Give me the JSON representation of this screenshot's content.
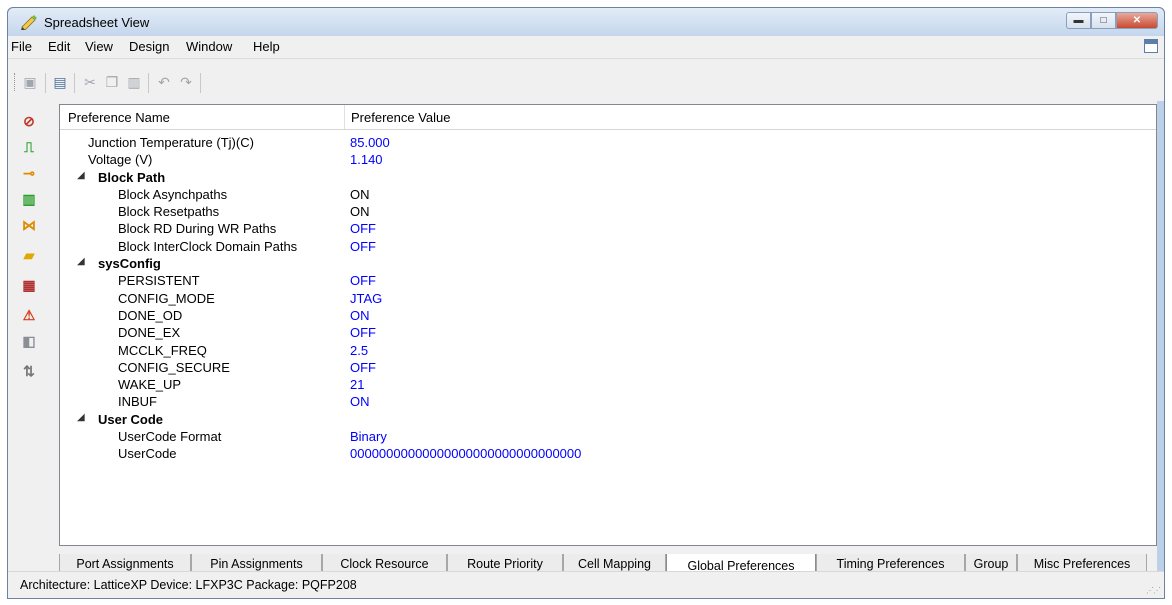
{
  "window": {
    "title": "Spreadsheet View"
  },
  "menu": [
    "File",
    "Edit",
    "View",
    "Design",
    "Window",
    "Help"
  ],
  "grid": {
    "headers": {
      "name": "Preference Name",
      "value": "Preference Value"
    },
    "rows": [
      {
        "indent": 1,
        "name": "Junction Temperature (Tj)(C)",
        "value": "85.000",
        "blue": true
      },
      {
        "indent": 1,
        "name": "Voltage (V)",
        "value": "1.140",
        "blue": true
      },
      {
        "indent": 0,
        "group": true,
        "name": "Block Path"
      },
      {
        "indent": 2,
        "name": "Block Asynchpaths",
        "value": "ON",
        "blue": false
      },
      {
        "indent": 2,
        "name": "Block Resetpaths",
        "value": "ON",
        "blue": false
      },
      {
        "indent": 2,
        "name": "Block RD During WR Paths",
        "value": "OFF",
        "blue": true
      },
      {
        "indent": 2,
        "name": "Block InterClock Domain Paths",
        "value": "OFF",
        "blue": true
      },
      {
        "indent": 0,
        "group": true,
        "name": "sysConfig"
      },
      {
        "indent": 2,
        "name": "PERSISTENT",
        "value": "OFF",
        "blue": true
      },
      {
        "indent": 2,
        "name": "CONFIG_MODE",
        "value": "JTAG",
        "blue": true
      },
      {
        "indent": 2,
        "name": "DONE_OD",
        "value": "ON",
        "blue": true
      },
      {
        "indent": 2,
        "name": "DONE_EX",
        "value": "OFF",
        "blue": true
      },
      {
        "indent": 2,
        "name": "MCCLK_FREQ",
        "value": "2.5",
        "blue": true
      },
      {
        "indent": 2,
        "name": "CONFIG_SECURE",
        "value": "OFF",
        "blue": true
      },
      {
        "indent": 2,
        "name": "WAKE_UP",
        "value": "21",
        "blue": true
      },
      {
        "indent": 2,
        "name": "INBUF",
        "value": "ON",
        "blue": true
      },
      {
        "indent": 0,
        "group": true,
        "name": "User Code"
      },
      {
        "indent": 2,
        "name": "UserCode Format",
        "value": "Binary",
        "blue": true
      },
      {
        "indent": 2,
        "name": "UserCode",
        "value": "00000000000000000000000000000000",
        "blue": true
      }
    ]
  },
  "tabs": [
    "Port Assignments",
    "Pin Assignments",
    "Clock Resource",
    "Route Priority",
    "Cell Mapping",
    "Global Preferences",
    "Timing Preferences",
    "Group",
    "Misc Preferences"
  ],
  "active_tab": "Global Preferences",
  "status": {
    "text": "Architecture: LatticeXP  Device: LFXP3C  Package: PQFP208"
  },
  "colors": {
    "value_blue": "#0000ff",
    "titlebar": "#c4d6ec",
    "close": "#c84a31"
  }
}
